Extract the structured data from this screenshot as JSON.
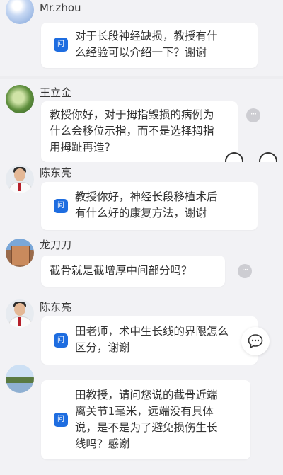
{
  "q_badge": "问",
  "more_glyph": "···",
  "posts": [
    {
      "name": "Mr.zhou",
      "avatar": "sky-avatar",
      "lines": [
        "对于长段神经缺损，教授有什",
        "么经验可以介绍一下？谢谢"
      ],
      "badge": true
    },
    {
      "name": "王立金",
      "avatar": "leaf-avatar",
      "lines": [
        "教授你好，对于拇指毁损的病例为",
        "什么会移位示指，而不是选择拇指",
        "用拇趾再造？"
      ],
      "badge": false
    },
    {
      "name": "陈东亮",
      "avatar": "doctor-avatar",
      "lines": [
        "教授你好，神经长段移植术后",
        "有什么好的康复方法，谢谢"
      ],
      "badge": true
    },
    {
      "name": "龙刀刀",
      "avatar": "building-avatar",
      "lines": [
        "截骨就是截增厚中间部分吗？"
      ],
      "badge": false
    },
    {
      "name": "陈东亮",
      "avatar": "doctor-avatar",
      "lines": [
        "田老师，术中生长线的界限怎么",
        "区分，谢谢"
      ],
      "badge": true
    },
    {
      "name": "",
      "avatar": "lake-avatar",
      "lines": [
        "田教授，请问您说的截骨近端",
        "离关节1毫米，远端没有具体",
        "说，是不是为了避免损伤生长",
        "线吗？感谢"
      ],
      "badge": true
    }
  ]
}
